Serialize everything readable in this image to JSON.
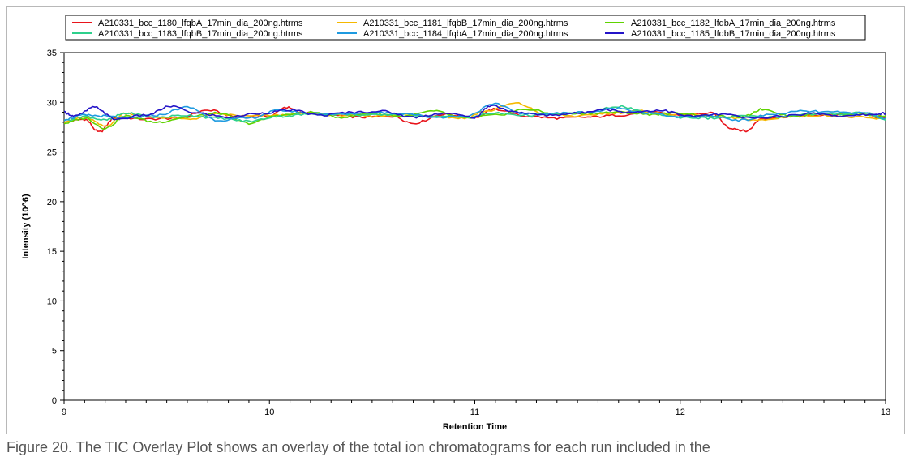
{
  "caption": "Figure 20. The TIC Overlay Plot shows an overlay of the total ion chromatograms for each run included in the",
  "chart_data": {
    "type": "line",
    "title": "",
    "xlabel": "Retention Time",
    "ylabel": "Intensity (10^6)",
    "xlim": [
      9,
      13
    ],
    "ylim": [
      0,
      35
    ],
    "x_ticks": [
      9,
      10,
      11,
      12,
      13
    ],
    "y_ticks": [
      0,
      5,
      10,
      15,
      20,
      25,
      30,
      35
    ],
    "grid": false,
    "legend_position": "top",
    "series": [
      {
        "name": "A210331_bcc_1180_lfqbA_17min_dia_200ng.htrms",
        "color": "#e8141b",
        "x": [
          9.0,
          9.1,
          9.17,
          9.25,
          9.4,
          9.55,
          9.7,
          9.85,
          10.0,
          10.08,
          10.15,
          10.3,
          10.45,
          10.6,
          10.7,
          10.85,
          11.0,
          11.1,
          11.25,
          11.4,
          11.55,
          11.7,
          11.85,
          12.0,
          12.15,
          12.25,
          12.32,
          12.4,
          12.55,
          12.7,
          12.85,
          13.0
        ],
        "y": [
          28.0,
          28.3,
          27.0,
          28.5,
          28.3,
          28.4,
          29.2,
          28.5,
          28.6,
          29.5,
          29.0,
          28.7,
          28.5,
          28.6,
          27.9,
          28.8,
          28.5,
          29.3,
          28.6,
          28.4,
          28.5,
          28.7,
          29.0,
          28.7,
          28.9,
          27.4,
          27.1,
          28.4,
          28.6,
          28.7,
          28.9,
          28.4
        ]
      },
      {
        "name": "A210331_bcc_1181_lfqbB_17min_dia_200ng.htrms",
        "color": "#f5b800",
        "x": [
          9.0,
          9.1,
          9.2,
          9.3,
          9.45,
          9.6,
          9.75,
          9.9,
          10.05,
          10.2,
          10.35,
          10.5,
          10.65,
          10.8,
          10.95,
          11.05,
          11.2,
          11.35,
          11.5,
          11.65,
          11.8,
          11.95,
          12.1,
          12.25,
          12.4,
          12.55,
          12.7,
          12.85,
          13.0
        ],
        "y": [
          28.1,
          28.5,
          27.6,
          28.9,
          28.5,
          28.3,
          28.8,
          28.6,
          28.7,
          28.9,
          28.7,
          28.6,
          28.8,
          28.6,
          28.4,
          29.1,
          29.9,
          28.8,
          28.6,
          28.9,
          29.1,
          28.8,
          28.7,
          28.4,
          28.2,
          28.6,
          28.7,
          28.5,
          28.3
        ]
      },
      {
        "name": "A210331_bcc_1182_lfqbA_17min_dia_200ng.htrms",
        "color": "#5fd300",
        "x": [
          9.0,
          9.1,
          9.2,
          9.3,
          9.45,
          9.6,
          9.75,
          9.9,
          10.05,
          10.2,
          10.35,
          10.5,
          10.65,
          10.8,
          10.95,
          11.1,
          11.25,
          11.4,
          11.55,
          11.7,
          11.85,
          12.0,
          12.15,
          12.3,
          12.4,
          12.55,
          12.7,
          12.85,
          13.0
        ],
        "y": [
          27.9,
          28.4,
          27.4,
          28.6,
          28.0,
          28.5,
          28.9,
          27.9,
          28.7,
          29.0,
          28.5,
          28.9,
          28.6,
          29.1,
          28.4,
          28.7,
          29.3,
          28.8,
          28.9,
          29.0,
          28.8,
          28.9,
          28.6,
          28.5,
          29.3,
          28.6,
          28.9,
          28.8,
          28.6
        ]
      },
      {
        "name": "A210331_bcc_1183_lfqbB_17min_dia_200ng.htrms",
        "color": "#2ed08c",
        "x": [
          9.0,
          9.1,
          9.2,
          9.3,
          9.45,
          9.6,
          9.75,
          9.9,
          10.05,
          10.2,
          10.35,
          10.5,
          10.65,
          10.8,
          10.95,
          11.1,
          11.25,
          11.4,
          11.55,
          11.7,
          11.85,
          12.0,
          12.15,
          12.3,
          12.45,
          12.6,
          12.75,
          12.9,
          13.0
        ],
        "y": [
          28.2,
          28.6,
          28.2,
          28.9,
          28.5,
          28.7,
          28.4,
          28.1,
          28.6,
          28.8,
          28.8,
          28.7,
          28.8,
          28.6,
          28.5,
          28.9,
          28.7,
          28.8,
          29.0,
          29.6,
          28.9,
          28.5,
          28.4,
          28.6,
          28.5,
          28.8,
          28.8,
          29.0,
          28.2
        ]
      },
      {
        "name": "A210331_bcc_1184_lfqbA_17min_dia_200ng.htrms",
        "color": "#1e9ae0",
        "x": [
          9.0,
          9.1,
          9.2,
          9.3,
          9.45,
          9.6,
          9.75,
          9.9,
          10.05,
          10.2,
          10.35,
          10.5,
          10.65,
          10.8,
          10.95,
          11.1,
          11.25,
          11.4,
          11.55,
          11.7,
          11.85,
          12.0,
          12.15,
          12.3,
          12.45,
          12.6,
          12.75,
          12.9,
          13.0
        ],
        "y": [
          28.3,
          28.7,
          28.6,
          28.4,
          28.7,
          29.5,
          28.2,
          28.4,
          29.2,
          28.9,
          28.8,
          29.0,
          28.9,
          28.5,
          28.6,
          29.8,
          28.8,
          28.9,
          29.0,
          29.4,
          28.9,
          28.5,
          28.6,
          28.2,
          28.8,
          29.1,
          29.0,
          28.9,
          28.4
        ]
      },
      {
        "name": "A210331_bcc_1185_lfqbB_17min_dia_200ng.htrms",
        "color": "#2414c8",
        "x": [
          9.0,
          9.05,
          9.15,
          9.25,
          9.4,
          9.52,
          9.65,
          9.8,
          9.95,
          10.1,
          10.25,
          10.4,
          10.55,
          10.7,
          10.85,
          11.0,
          11.08,
          11.2,
          11.35,
          11.5,
          11.62,
          11.75,
          11.9,
          12.05,
          12.2,
          12.35,
          12.5,
          12.65,
          12.8,
          12.95,
          13.0
        ],
        "y": [
          29.0,
          28.6,
          29.5,
          28.3,
          28.7,
          29.6,
          28.9,
          28.5,
          28.9,
          29.2,
          28.7,
          29.0,
          29.1,
          28.5,
          28.9,
          28.5,
          29.7,
          29.0,
          28.7,
          28.9,
          29.3,
          29.0,
          29.2,
          28.6,
          28.8,
          28.4,
          28.6,
          28.9,
          28.6,
          28.8,
          28.9
        ]
      }
    ]
  }
}
